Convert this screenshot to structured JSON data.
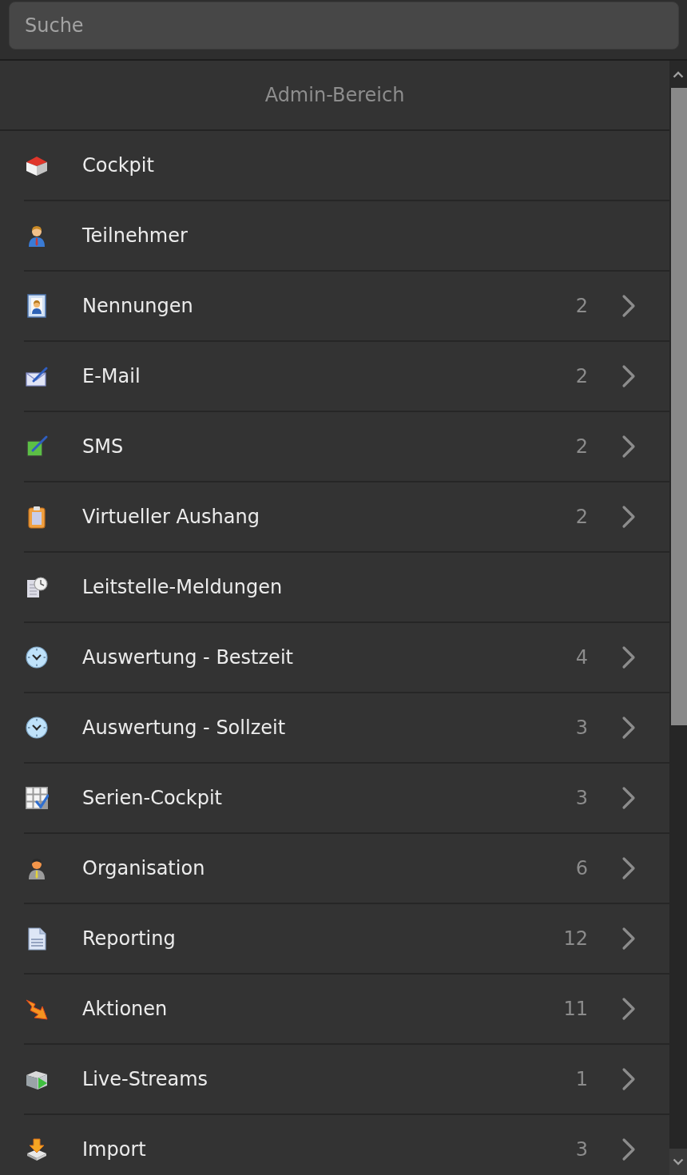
{
  "search": {
    "placeholder": "Suche"
  },
  "menu": {
    "title": "Admin-Bereich",
    "items": [
      {
        "label": "Cockpit",
        "submenu": false
      },
      {
        "label": "Teilnehmer",
        "submenu": false
      },
      {
        "label": "Nennungen",
        "count": "2",
        "submenu": true
      },
      {
        "label": "E-Mail",
        "count": "2",
        "submenu": true
      },
      {
        "label": "SMS",
        "count": "2",
        "submenu": true
      },
      {
        "label": "Virtueller Aushang",
        "count": "2",
        "submenu": true
      },
      {
        "label": "Leitstelle-Meldungen",
        "submenu": false
      },
      {
        "label": "Auswertung - Bestzeit",
        "count": "4",
        "submenu": true
      },
      {
        "label": "Auswertung - Sollzeit",
        "count": "3",
        "submenu": true
      },
      {
        "label": "Serien-Cockpit",
        "count": "3",
        "submenu": true
      },
      {
        "label": "Organisation",
        "count": "6",
        "submenu": true
      },
      {
        "label": "Reporting",
        "count": "12",
        "submenu": true
      },
      {
        "label": "Aktionen",
        "count": "11",
        "submenu": true
      },
      {
        "label": "Live-Streams",
        "count": "1",
        "submenu": true
      },
      {
        "label": "Import",
        "count": "3",
        "submenu": true
      }
    ]
  }
}
